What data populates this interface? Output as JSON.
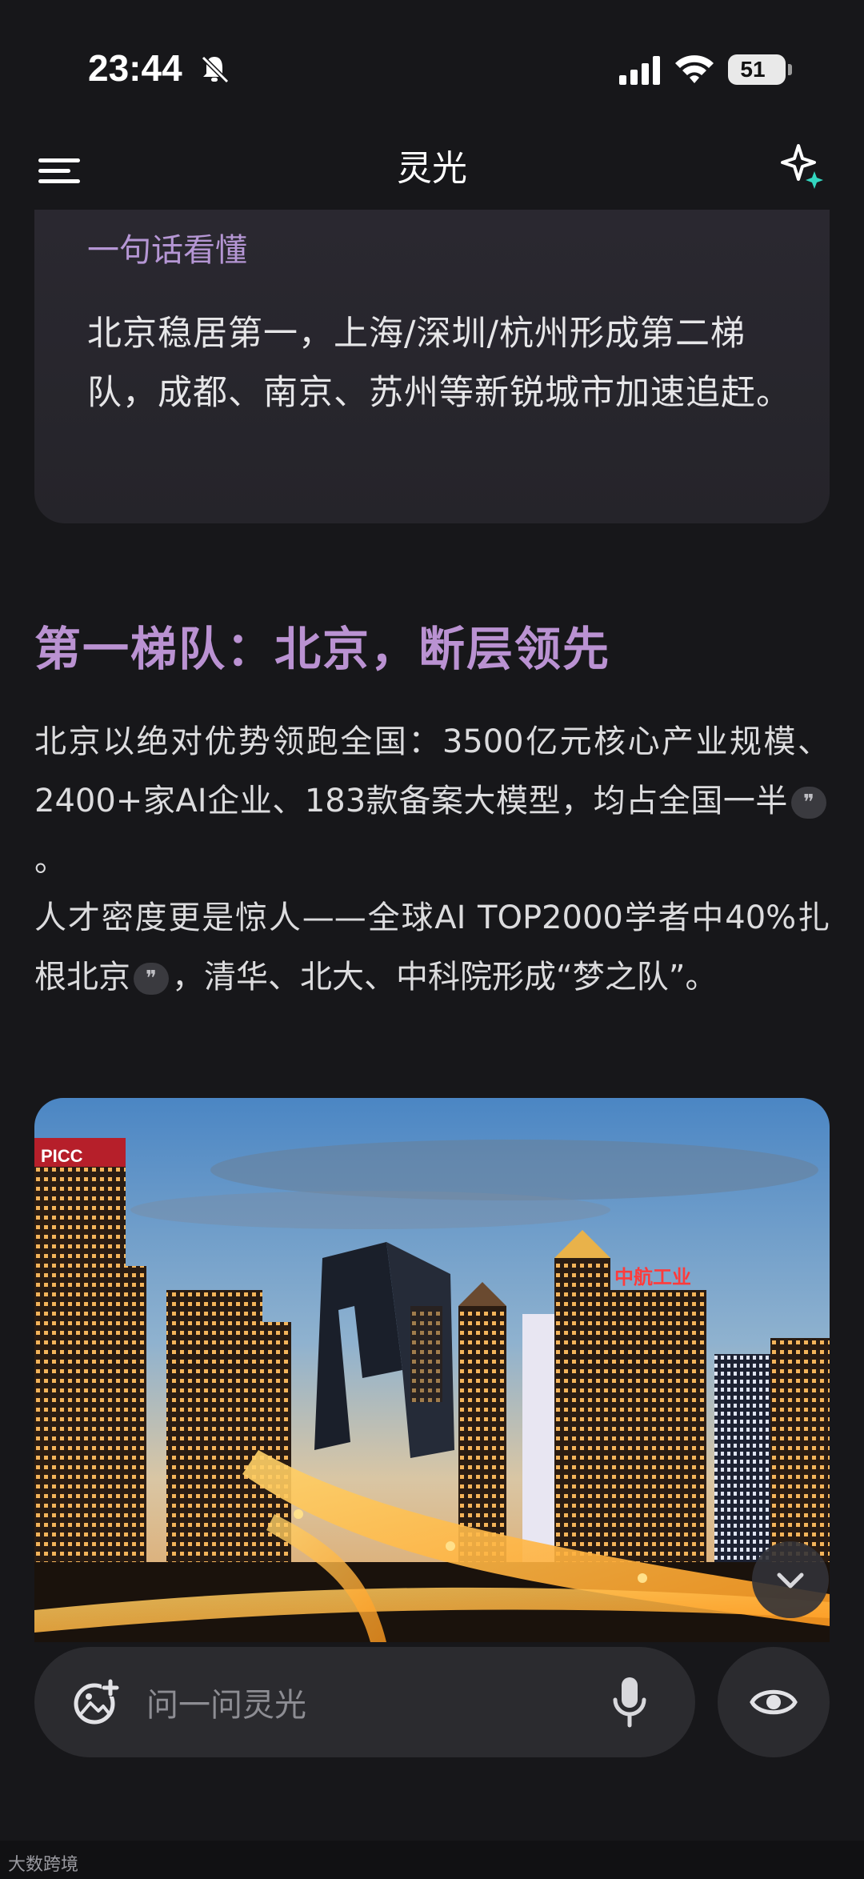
{
  "status_bar": {
    "time": "23:44",
    "battery": "51"
  },
  "header": {
    "title": "灵光"
  },
  "summary": {
    "title": "一句话看懂",
    "text": "北京稳居第一，上海/深圳/杭州形成第二梯队，成都、南京、苏州等新锐城市加速追赶。"
  },
  "section": {
    "heading": "第一梯队：北京，断层领先",
    "p1_text": "北京以绝对优势领跑全国：3500亿元核心产业规模、2400+家AI企业、183款备案大模型，均占全国一半",
    "p1_end": "。",
    "p2_text": "人才密度更是惊人——全球AI TOP2000学者中40%扎根北京",
    "p2_end": "，清华、北大、中科院形成“梦之队”。",
    "cite_glyph": "❞"
  },
  "image": {
    "signs": [
      "PICC",
      "中航工业"
    ]
  },
  "input": {
    "placeholder": "问一问灵光"
  },
  "watermark": "大数跨境",
  "icons": {
    "menu": "menu-icon",
    "sparkle": "sparkle-icon",
    "add_photo": "add-photo-icon",
    "mic": "mic-icon",
    "eye": "eye-icon",
    "chevron": "chevron-down-icon"
  },
  "colors": {
    "accent_purple": "#ba92d2",
    "background": "#17171a",
    "card": "#2a2830"
  }
}
